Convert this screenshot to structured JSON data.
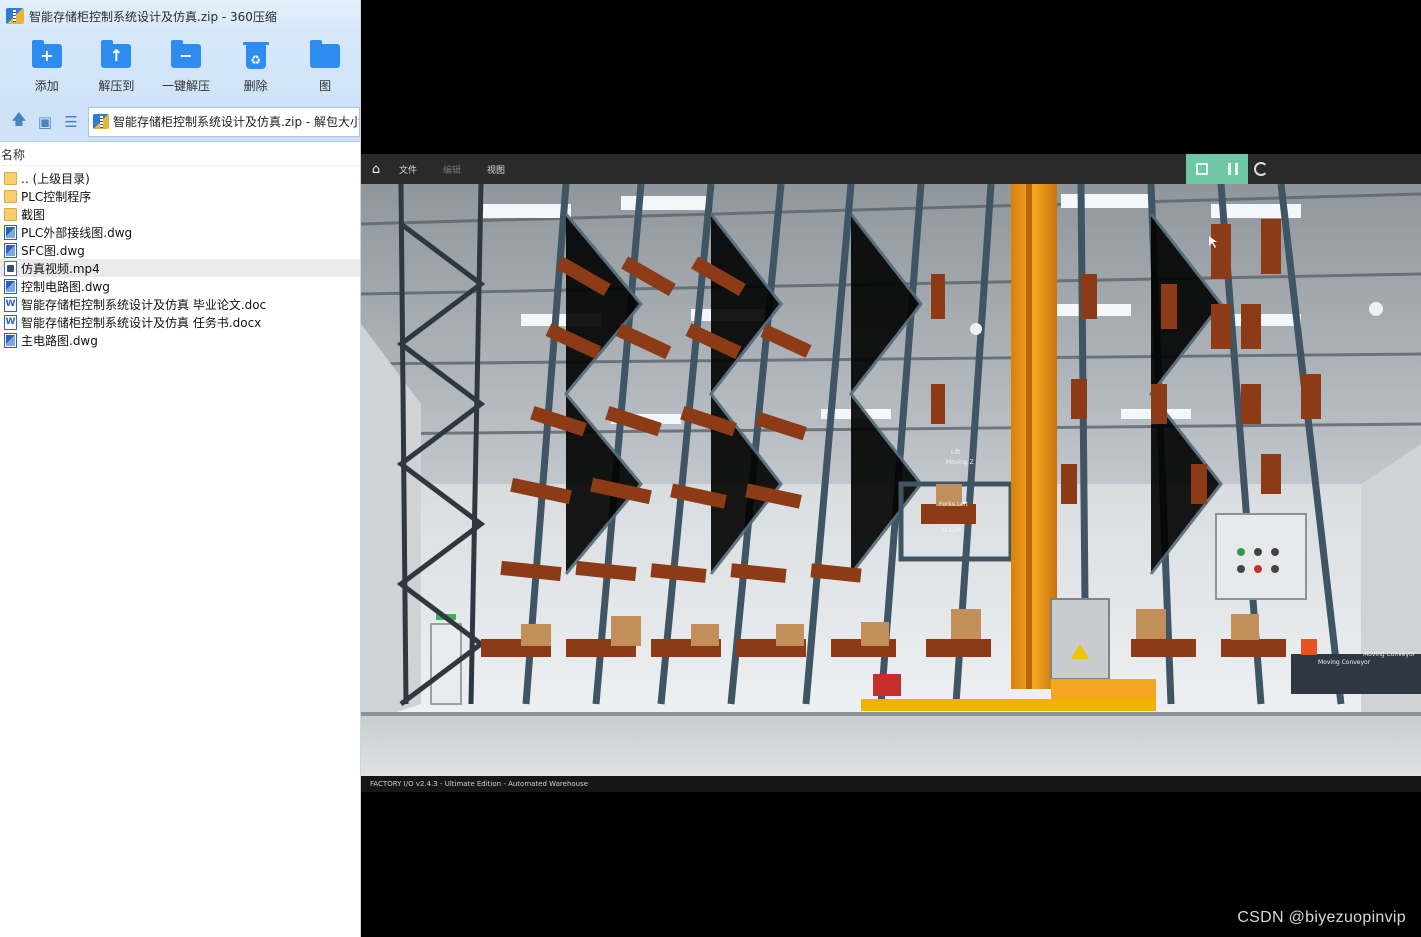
{
  "zip_window": {
    "title": "智能存储柜控制系统设计及仿真.zip - 360压缩",
    "toolbar": [
      {
        "label": "添加",
        "icon": "add-icon"
      },
      {
        "label": "解压到",
        "icon": "extract-to-icon"
      },
      {
        "label": "一键解压",
        "icon": "one-click-extract-icon"
      },
      {
        "label": "删除",
        "icon": "delete-icon"
      },
      {
        "label": "图",
        "icon": "image-tool-icon"
      }
    ],
    "path": "智能存储柜控制系统设计及仿真.zip - 解包大小",
    "column_name": "名称",
    "files": [
      {
        "name": ".. (上级目录)",
        "type": "folder"
      },
      {
        "name": "PLC控制程序",
        "type": "folder"
      },
      {
        "name": "截图",
        "type": "folder"
      },
      {
        "name": "PLC外部接线图.dwg",
        "type": "dwg"
      },
      {
        "name": "SFC图.dwg",
        "type": "dwg"
      },
      {
        "name": "仿真视频.mp4",
        "type": "mp4",
        "selected": true
      },
      {
        "name": "控制电路图.dwg",
        "type": "dwg"
      },
      {
        "name": "智能存储柜控制系统设计及仿真 毕业论文.doc",
        "type": "doc"
      },
      {
        "name": "智能存储柜控制系统设计及仿真 任务书.docx",
        "type": "doc"
      },
      {
        "name": "主电路图.dwg",
        "type": "dwg"
      }
    ]
  },
  "video": {
    "menu": [
      "文件",
      "编辑",
      "视图"
    ],
    "status": "FACTORY I/O v2.4.3 - Ultimate Edition - Automated Warehouse",
    "scene_labels": [
      "Lift",
      "Moving Z",
      "Forks Left",
      "At Left",
      "Moving Conveyor",
      "Moving Conveyor"
    ]
  },
  "watermark": "CSDN @biyezuopinvip"
}
